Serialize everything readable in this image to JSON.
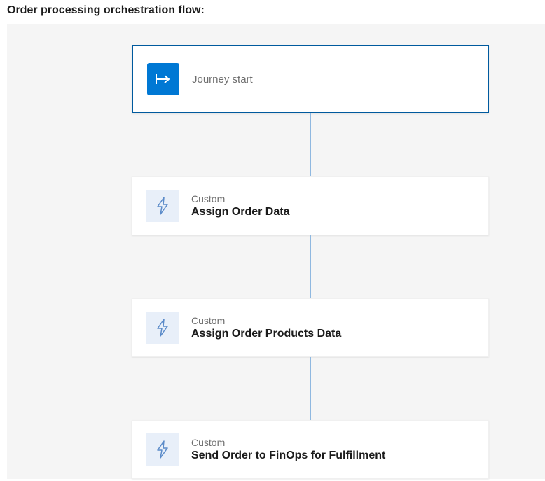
{
  "header": {
    "title": "Order processing orchestration flow:"
  },
  "flow": {
    "start": {
      "label": "Journey start"
    },
    "nodes": [
      {
        "category": "Custom",
        "title": "Assign Order Data"
      },
      {
        "category": "Custom",
        "title": "Assign Order Products Data"
      },
      {
        "category": "Custom",
        "title": "Send Order to FinOps for Fulfillment"
      }
    ]
  },
  "colors": {
    "accent": "#0078d4",
    "selection_border": "#005a9e",
    "connector": "#8fb8e0",
    "canvas_bg": "#f5f5f5",
    "icon_bg_light": "#e8eff9"
  }
}
